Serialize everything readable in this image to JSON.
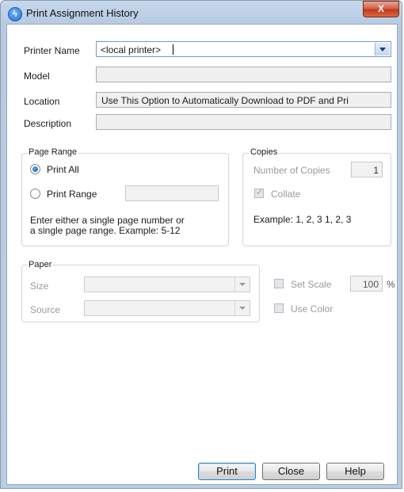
{
  "window": {
    "title": "Print Assignment History",
    "close_glyph": "X",
    "app_icon": "lightning-icon"
  },
  "printer": {
    "name_label": "Printer Name",
    "name_value": "<local printer>",
    "model_label": "Model",
    "model_value": "",
    "location_label": "Location",
    "location_value": "Use This Option to Automatically Download to PDF and Pri",
    "description_label": "Description",
    "description_value": ""
  },
  "page_range": {
    "legend": "Page Range",
    "print_all_label": "Print All",
    "print_range_label": "Print Range",
    "range_value": "",
    "help_line1": "Enter either a single page number or",
    "help_line2": "a single page range.  Example: 5-12",
    "selected": "Print All"
  },
  "copies": {
    "legend": "Copies",
    "number_label": "Number of Copies",
    "number_value": "1",
    "collate_label": "Collate",
    "collate_checked": true,
    "example": "Example: 1, 2, 3   1, 2, 3"
  },
  "paper": {
    "legend": "Paper",
    "size_label": "Size",
    "size_value": "",
    "source_label": "Source",
    "source_value": ""
  },
  "options": {
    "set_scale_label": "Set Scale",
    "scale_value": "100",
    "scale_unit": "%",
    "use_color_label": "Use Color",
    "set_scale_checked": false,
    "use_color_checked": false
  },
  "buttons": {
    "print": "Print",
    "close": "Close",
    "help": "Help"
  }
}
